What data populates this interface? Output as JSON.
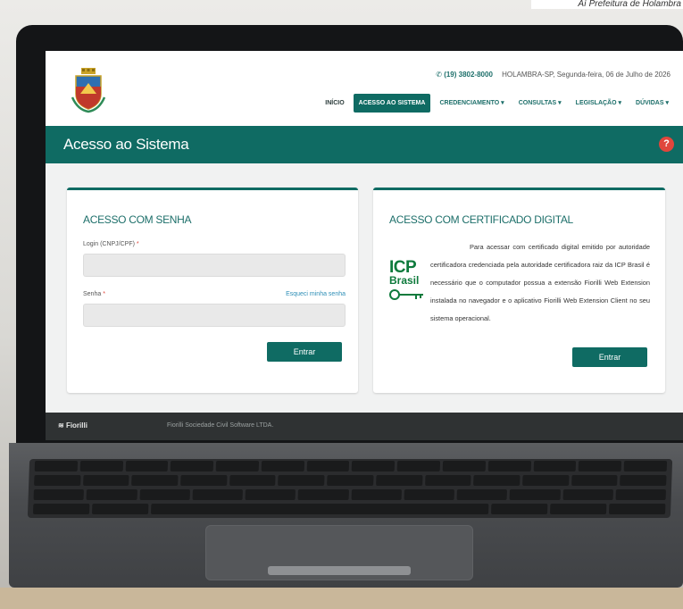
{
  "caption": "Aí Prefeitura de Holambra",
  "header": {
    "phone": "(19) 3802-8000",
    "location_date": "HOLAMBRA-SP, Segunda-feira, 06 de Julho de 2026",
    "nav": [
      {
        "label": "INÍCIO"
      },
      {
        "label": "ACESSO AO SISTEMA"
      },
      {
        "label": "CREDENCIAMENTO ▾"
      },
      {
        "label": "CONSULTAS ▾"
      },
      {
        "label": "LEGISLAÇÃO ▾"
      },
      {
        "label": "DÚVIDAS ▾"
      }
    ]
  },
  "page_title": "Acesso ao Sistema",
  "help_label": "?",
  "login_card": {
    "title": "ACESSO COM SENHA",
    "login_label": "Login (CNPJ/CPF)",
    "password_label": "Senha",
    "required_mark": "*",
    "forgot_link": "Esqueci minha senha",
    "login_value": "",
    "password_value": "",
    "submit": "Entrar"
  },
  "cert_card": {
    "title": "ACESSO COM CERTIFICADO DIGITAL",
    "icp_main": "ICP",
    "icp_sub": "Brasil",
    "text": "Para acessar com certificado digital emitido por autoridade certificadora credenciada pela autoridade certificadora raiz da ICP Brasil é necessário que o computador possua a extensão Fiorilli Web Extension instalada no navegador e o aplicativo Fiorilli Web Extension Client no seu sistema operacional.",
    "submit": "Entrar"
  },
  "footer": {
    "brand": "Fiorilli",
    "company": "Fiorilli Sociedade Civil Software LTDA."
  },
  "colors": {
    "teal": "#0f6b63",
    "help_red": "#e0463c",
    "link_blue": "#2e8fb7",
    "icp_green": "#0e7a3c"
  }
}
